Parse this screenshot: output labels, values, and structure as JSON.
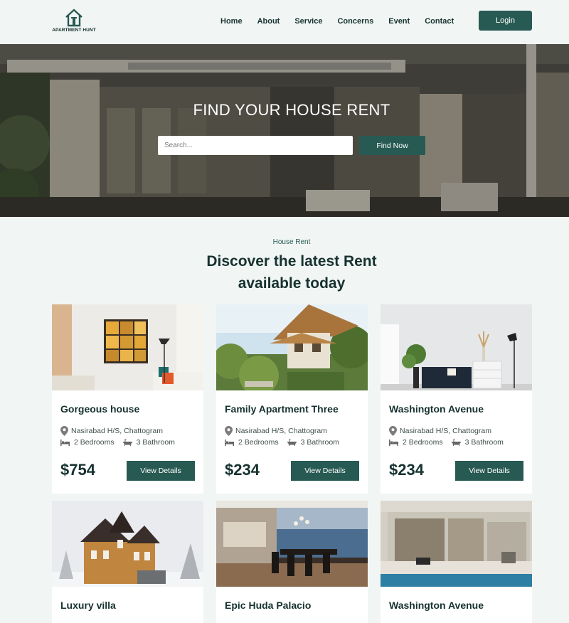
{
  "brand": {
    "name": "APARTMENT HUNT"
  },
  "nav": {
    "items": [
      {
        "label": "Home"
      },
      {
        "label": "About"
      },
      {
        "label": "Service"
      },
      {
        "label": "Concerns"
      },
      {
        "label": "Event"
      },
      {
        "label": "Contact"
      }
    ],
    "login_label": "Login"
  },
  "hero": {
    "title": "FIND YOUR HOUSE RENT",
    "search_placeholder": "Search...",
    "button_label": "Find Now"
  },
  "section": {
    "eyebrow": "House Rent",
    "headline_line1": "Discover the latest Rent",
    "headline_line2": "available today"
  },
  "cards": [
    {
      "title": "Gorgeous house",
      "location": "Nasirabad H/S, Chattogram",
      "bedrooms": "2 Bedrooms",
      "bathrooms": "3 Bathroom",
      "price": "$754",
      "button": "View Details"
    },
    {
      "title": "Family Apartment Three",
      "location": "Nasirabad H/S, Chattogram",
      "bedrooms": "2 Bedrooms",
      "bathrooms": "3 Bathroom",
      "price": "$234",
      "button": "View Details"
    },
    {
      "title": "Washington Avenue",
      "location": "Nasirabad H/S, Chattogram",
      "bedrooms": "2 Bedrooms",
      "bathrooms": "3 Bathroom",
      "price": "$234",
      "button": "View Details"
    },
    {
      "title": "Luxury villa"
    },
    {
      "title": "Epic Huda Palacio"
    },
    {
      "title": "Washington Avenue"
    }
  ],
  "colors": {
    "accent": "#275a53",
    "background": "#f1f6f4",
    "text": "#16322f"
  }
}
